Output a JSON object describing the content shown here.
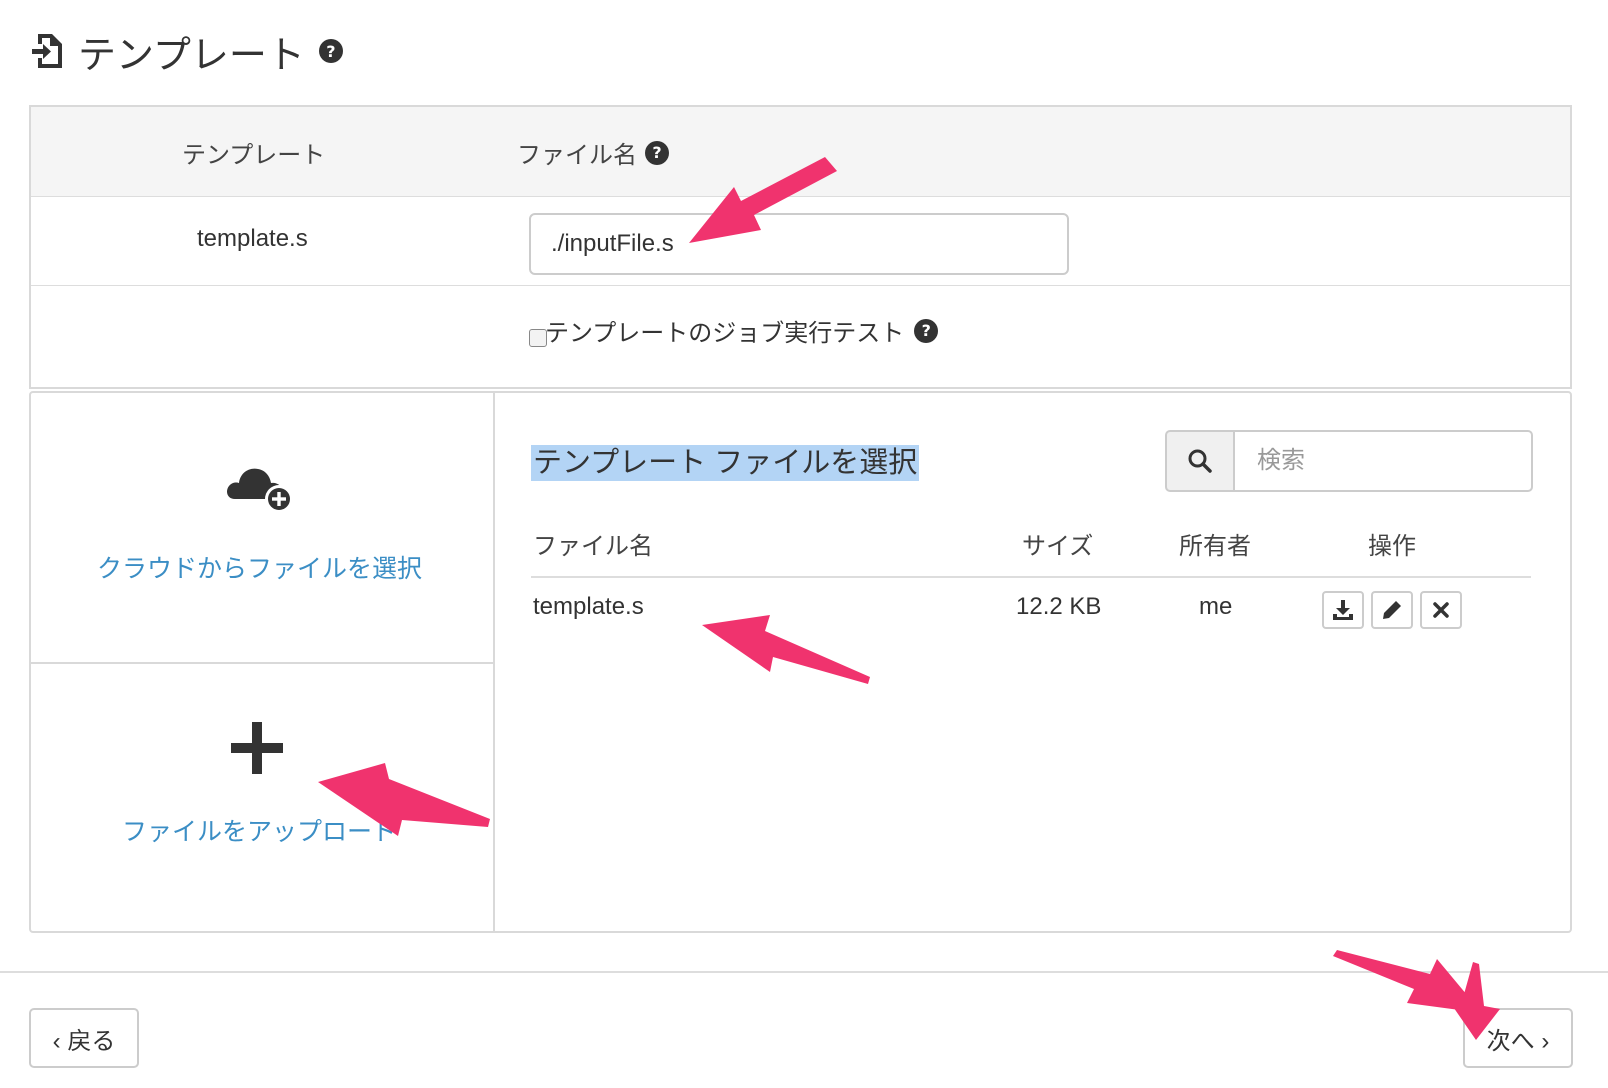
{
  "page": {
    "title": "テンプレート"
  },
  "template_table": {
    "col_template": "テンプレート",
    "col_filename": "ファイル名",
    "template_name": "template.s",
    "filename_value": "./inputFile.s",
    "test_checkbox_label": "テンプレートのジョブ実行テスト",
    "test_checked": false
  },
  "sources": {
    "cloud_label": "クラウドからファイルを選択",
    "upload_label": "ファイルをアップロード"
  },
  "file_selector": {
    "title": "テンプレート ファイルを選択",
    "search_placeholder": "検索",
    "columns": {
      "name": "ファイル名",
      "size": "サイズ",
      "owner": "所有者",
      "actions": "操作"
    },
    "rows": [
      {
        "name": "template.s",
        "size": "12.2 KB",
        "owner": "me"
      }
    ]
  },
  "footer": {
    "back_label": "‹ 戻る",
    "next_label": "次へ ›"
  },
  "colors": {
    "link": "#3b8ec5",
    "annotation_arrow": "#f0336e",
    "selection_highlight": "#b3d4f5"
  },
  "icons": [
    "file-import-icon",
    "help-icon",
    "cloud-plus-icon",
    "plus-icon",
    "search-icon",
    "download-icon",
    "pencil-icon",
    "close-icon"
  ]
}
